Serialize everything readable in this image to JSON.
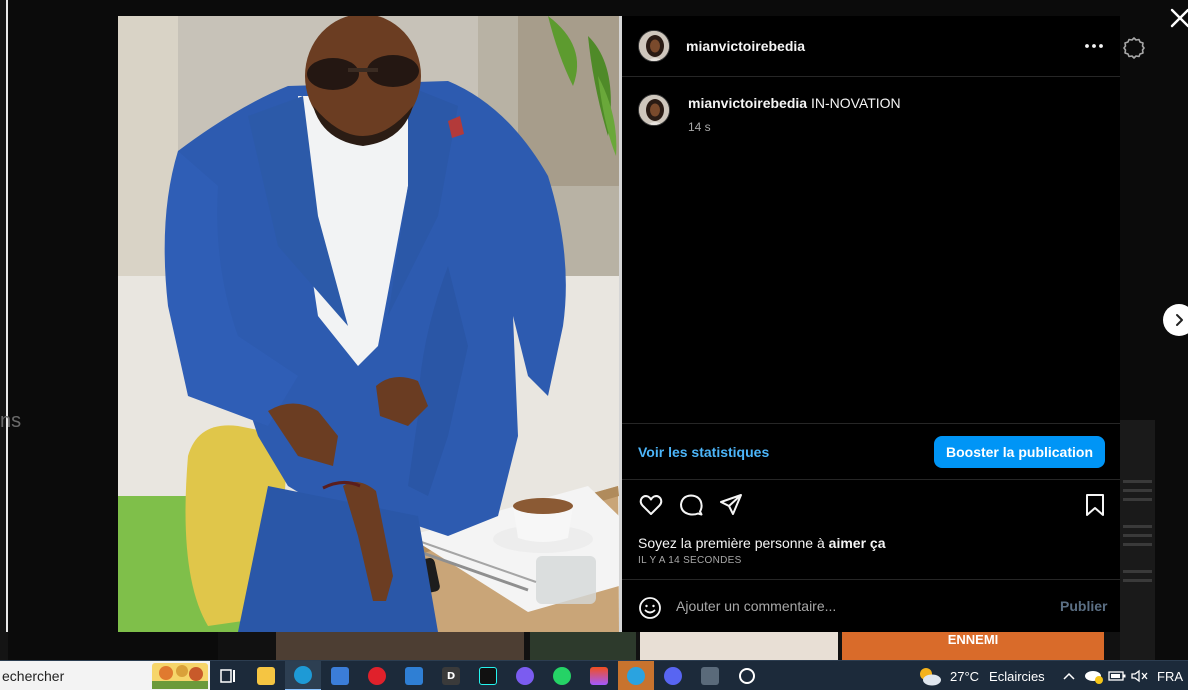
{
  "background": {
    "side_letters": [
      "ns"
    ],
    "banner_text": "ENNEMI"
  },
  "post": {
    "username": "mianvictoirebedia",
    "caption": "IN-NOVATION",
    "caption_time": "14 s",
    "view_stats_label": "Voir les statistiques",
    "boost_label": "Booster la publication",
    "likes_prefix": "Soyez la première personne à",
    "likes_link": "aimer ça",
    "posted_time": "IL Y A 14 SECONDES",
    "comment_placeholder": "Ajouter un commentaire...",
    "publish_label": "Publier",
    "liked": false,
    "saved": false
  },
  "taskbar": {
    "search_placeholder": "echercher",
    "apps": [
      {
        "name": "task-view",
        "icon": "task-view-icon"
      },
      {
        "name": "file-explorer",
        "icon": "folder-icon"
      },
      {
        "name": "edge",
        "icon": "edge-icon",
        "active": true
      },
      {
        "name": "store",
        "icon": "store-icon"
      },
      {
        "name": "opera",
        "icon": "opera-icon"
      },
      {
        "name": "mail",
        "icon": "mail-icon"
      },
      {
        "name": "app-d",
        "icon": "d-app-icon",
        "glyph": "D"
      },
      {
        "name": "tiktok",
        "icon": "tiktok-icon"
      },
      {
        "name": "clipchamp",
        "icon": "clipchamp-icon"
      },
      {
        "name": "whatsapp",
        "icon": "whatsapp-icon"
      },
      {
        "name": "figma",
        "icon": "figma-icon"
      },
      {
        "name": "telegram",
        "icon": "telegram-icon",
        "active": true
      },
      {
        "name": "discord",
        "icon": "discord-icon"
      },
      {
        "name": "calculator",
        "icon": "calculator-icon"
      },
      {
        "name": "app-circle",
        "icon": "circle-app-icon"
      }
    ],
    "weather_temp": "27°C",
    "weather_desc": "Eclaircies",
    "language": "FRA"
  },
  "colors": {
    "accent": "#0095f6",
    "link": "#4cb5f9",
    "panel_bg": "#000000",
    "taskbar_bg": "#1c2a3a"
  }
}
